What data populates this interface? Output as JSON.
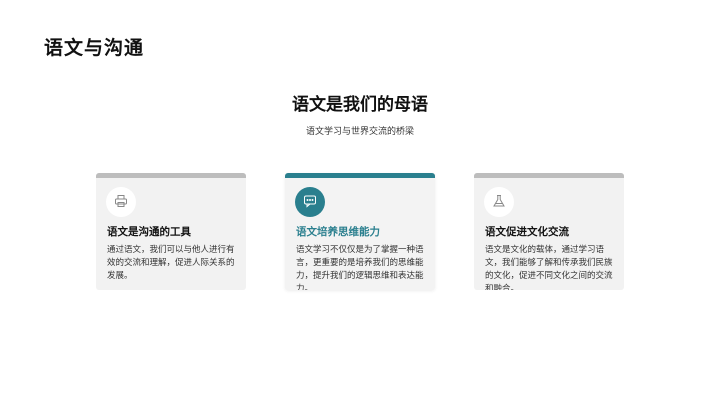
{
  "slide": {
    "title": "语文与沟通",
    "heading": "语文是我们的母语",
    "subheading": "语文学习与世界交流的桥梁"
  },
  "cards": [
    {
      "icon": "printer-icon",
      "title": "语文是沟通的工具",
      "body": "通过语文，我们可以与他人进行有效的交流和理解，促进人际关系的发展。"
    },
    {
      "icon": "chat-icon",
      "title": "语文培养思维能力",
      "body": "语文学习不仅仅是为了掌握一种语言，更重要的是培养我们的思维能力，提升我们的逻辑思维和表达能力。"
    },
    {
      "icon": "flask-icon",
      "title": "语文促进文化交流",
      "body": "语文是文化的载体，通过学习语文，我们能够了解和传承我们民族的文化，促进不同文化之间的交流和融合。"
    }
  ],
  "colors": {
    "accent": "#2a7f8e",
    "card_bar": "#bdbdbd",
    "card_bg": "#f2f2f2"
  }
}
